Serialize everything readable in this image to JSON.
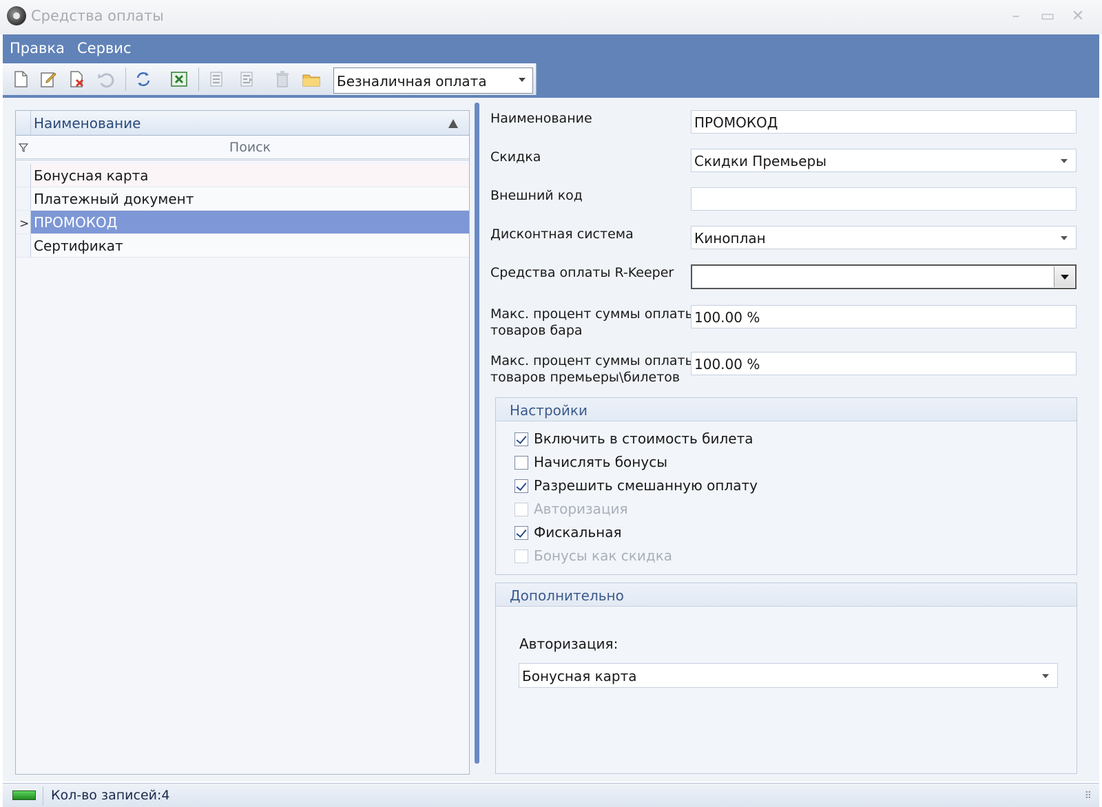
{
  "window": {
    "title": "Средства оплаты",
    "minimize": "–",
    "maximize": "▭",
    "close": "✕"
  },
  "menu": [
    "Правка",
    "Сервис"
  ],
  "toolbar": {
    "icons": [
      "new-document-icon",
      "edit-icon",
      "delete-icon",
      "undo-icon",
      "refresh-icon",
      "excel-export-icon",
      "move-up-icon",
      "move-down-icon",
      "trash-icon",
      "folder-icon"
    ],
    "payment_type": "Безналичная оплата"
  },
  "grid": {
    "column": "Наименование",
    "search_placeholder": "Поиск",
    "rows": [
      "Бонусная карта",
      "Платежный документ",
      "ПРОМОКОД",
      "Сертификат"
    ],
    "selected_index": 2
  },
  "form": {
    "name_label": "Наименование",
    "name_value": "ПРОМОКОД",
    "discount_label": "Скидка",
    "discount_value": "Скидки Премьеры",
    "ext_code_label": "Внешний код",
    "ext_code_value": "",
    "discount_system_label": "Дисконтная система",
    "discount_system_value": "Киноплан",
    "rkeeper_label": "Средства оплаты R-Keeper",
    "rkeeper_value": "",
    "max_bar_label_1": "Макс. процент суммы оплаты",
    "max_bar_label_2": "товаров бара",
    "max_bar_value": "100.00 %",
    "max_premiere_label_1": "Макс. процент суммы оплаты",
    "max_premiere_label_2": "товаров премьеры\\билетов",
    "max_premiere_value": "100.00 %"
  },
  "settings": {
    "title": "Настройки",
    "options": [
      {
        "label": "Включить в стоимость билета",
        "checked": true,
        "enabled": true
      },
      {
        "label": "Начислять бонусы",
        "checked": false,
        "enabled": true
      },
      {
        "label": "Разрешить смешанную оплату",
        "checked": true,
        "enabled": true
      },
      {
        "label": "Авторизация",
        "checked": false,
        "enabled": false
      },
      {
        "label": "Фискальная",
        "checked": true,
        "enabled": true
      },
      {
        "label": "Бонусы как скидка",
        "checked": false,
        "enabled": false
      }
    ]
  },
  "additional": {
    "title": "Дополнительно",
    "auth_label": "Авторизация:",
    "auth_value": "Бонусная карта"
  },
  "status": {
    "records": "Кол-во записей:4"
  },
  "colors": {
    "band": "#6183b8",
    "selection": "#7e97d6",
    "splitter": "#6a8ac4"
  }
}
